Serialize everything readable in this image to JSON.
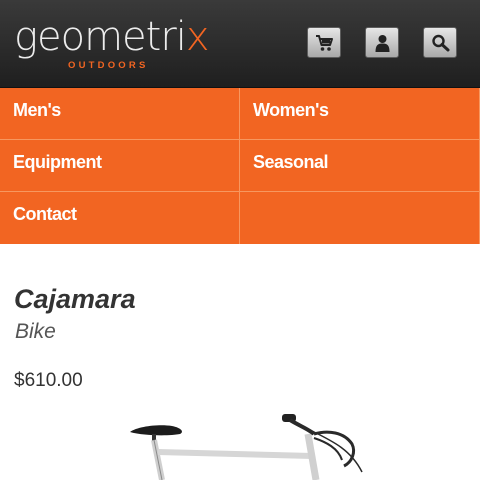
{
  "brand": {
    "name_main": "geometri",
    "name_accent": "x",
    "tagline": "OUTDOORS",
    "accent_color": "#f26522"
  },
  "header": {
    "icons": [
      "cart-icon",
      "account-icon",
      "search-icon"
    ]
  },
  "nav": {
    "items": [
      {
        "label": "Men's"
      },
      {
        "label": "Women's"
      },
      {
        "label": "Equipment"
      },
      {
        "label": "Seasonal"
      },
      {
        "label": "Contact"
      },
      {
        "label": ""
      }
    ]
  },
  "product": {
    "name": "Cajamara",
    "category": "Bike",
    "price": "$610.00",
    "image_icon": "bike-photo"
  }
}
